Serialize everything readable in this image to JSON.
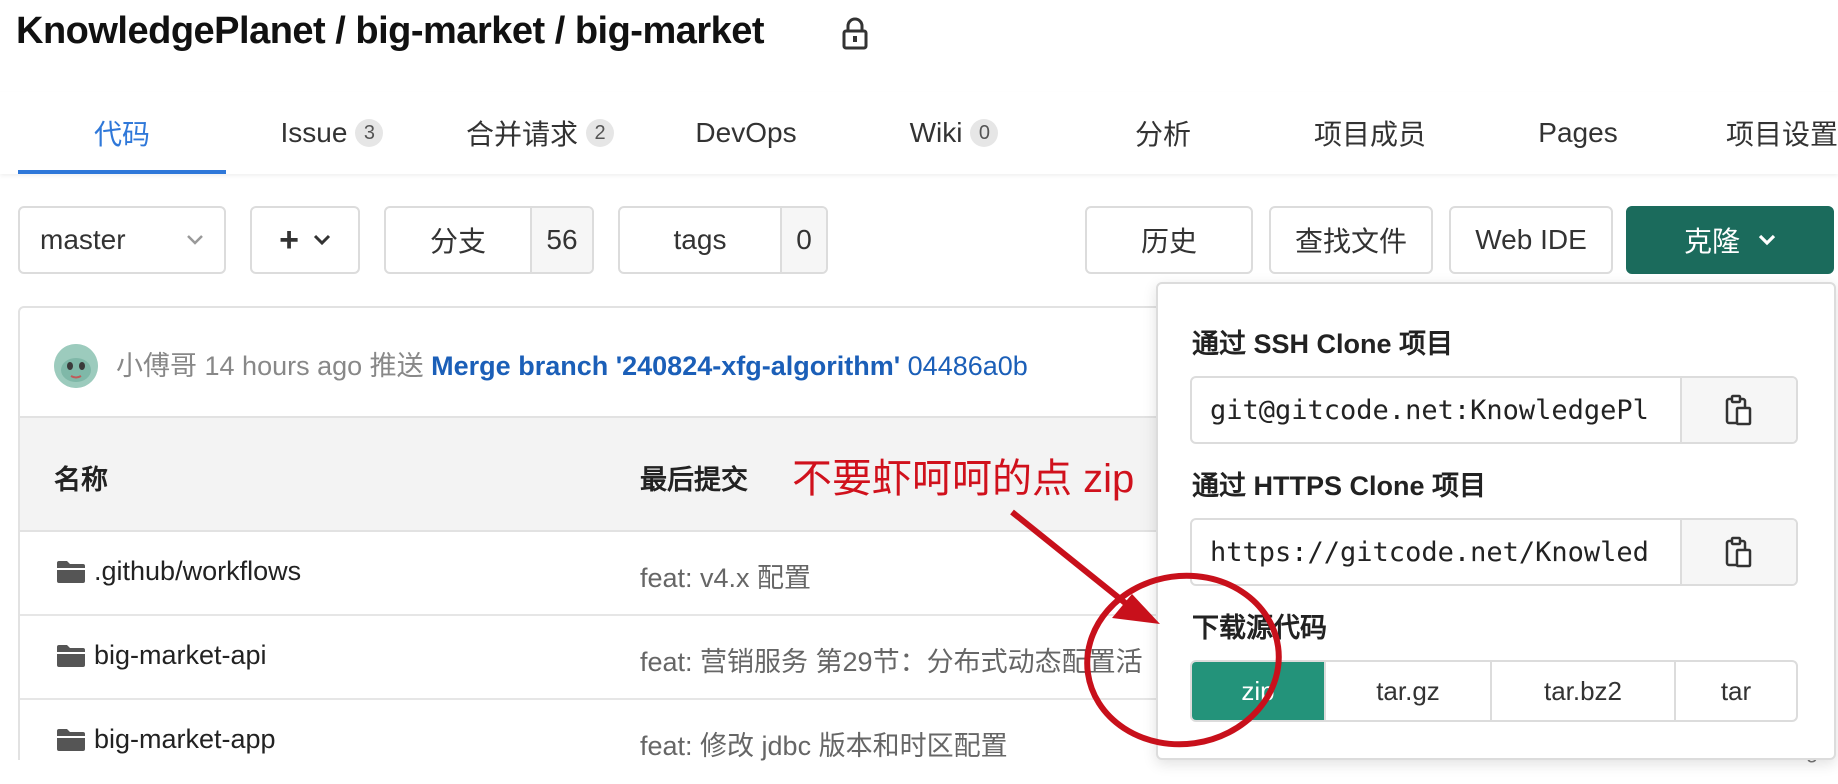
{
  "header": {
    "title": "KnowledgePlanet / big-market / big-market"
  },
  "tabs": [
    {
      "label": "代码",
      "active": true
    },
    {
      "label": "Issue",
      "count": "3"
    },
    {
      "label": "合并请求",
      "count": "2"
    },
    {
      "label": "DevOps"
    },
    {
      "label": "Wiki",
      "count": "0"
    },
    {
      "label": "分析"
    },
    {
      "label": "项目成员"
    },
    {
      "label": "Pages"
    },
    {
      "label": "项目设置"
    }
  ],
  "toolbar": {
    "branch": "master",
    "add": "+",
    "branches_label": "分支",
    "branches_count": "56",
    "tags_label": "tags",
    "tags_count": "0",
    "history": "历史",
    "find_file": "查找文件",
    "web_ide": "Web IDE",
    "clone": "克隆"
  },
  "commit": {
    "author": "小傅哥",
    "time": "14 hours ago",
    "action": "推送",
    "message": "Merge branch '240824-xfg-algorithm'",
    "sha": "04486a0b"
  },
  "files": {
    "headers": {
      "name": "名称",
      "last_commit": "最后提交"
    },
    "rows": [
      {
        "name": ".github/workflows",
        "message": "feat: v4.x 配置"
      },
      {
        "name": "big-market-api",
        "message": "feat: 营销服务 第29节：分布式动态配置活"
      },
      {
        "name": "big-market-app",
        "message": "feat: 修改 jdbc 版本和时区配置"
      }
    ]
  },
  "clone_dropdown": {
    "ssh_label": "通过 SSH Clone 项目",
    "ssh_url": "git@gitcode.net:KnowledgePl",
    "https_label": "通过 HTTPS Clone 项目",
    "https_url": "https://gitcode.net/Knowled",
    "download_label": "下载源代码",
    "formats": [
      "zip",
      "tar.gz",
      "tar.bz2",
      "tar"
    ]
  },
  "annotation": {
    "text": "不要虾呵呵的点 zip",
    "color": "#d0111c"
  },
  "edge_text": "g",
  "colors": {
    "accent": "#2f78d9",
    "clone_button": "#1b6b5c",
    "zip_button": "#23937a",
    "link": "#1b5fb8"
  }
}
